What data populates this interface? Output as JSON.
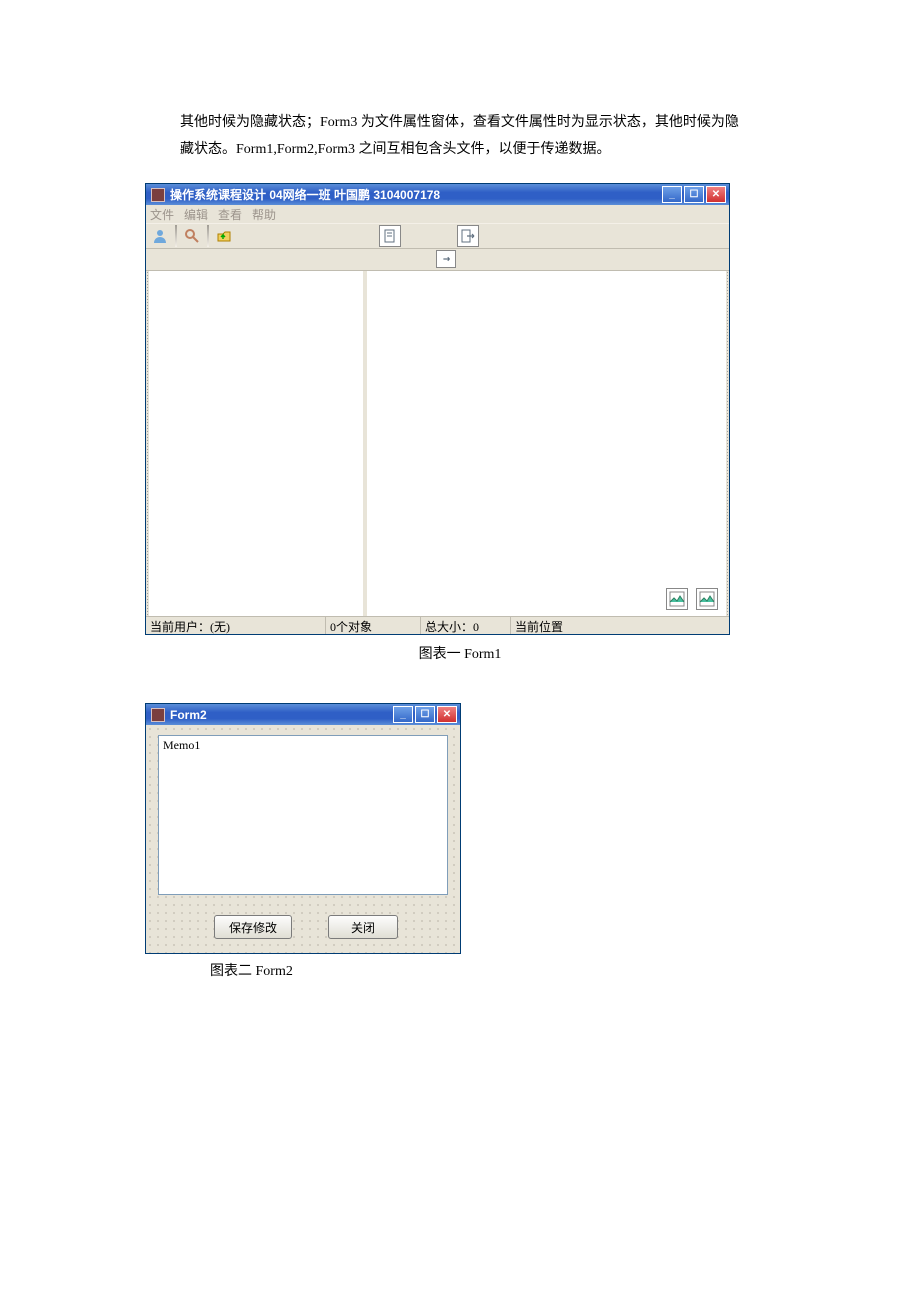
{
  "body": {
    "p1": "其他时候为隐藏状态；Form3 为文件属性窗体，查看文件属性时为显示状态，其他时候为隐藏状态。Form1,Form2,Form3 之间互相包含头文件，以便于传递数据。"
  },
  "form1": {
    "title": "操作系统课程设计   04网络一班  叶国鹏  3104007178",
    "menu": {
      "file": "文件",
      "edit": "编辑",
      "view": "查看",
      "help": "帮助"
    },
    "status": {
      "user_label": "当前用户：(无)",
      "objects": "0个对象",
      "size": "总大小：0",
      "location": "当前位置"
    }
  },
  "captions": {
    "fig1": "图表一  Form1",
    "fig2": "图表二  Form2"
  },
  "form2": {
    "title": "Form2",
    "memo": "Memo1",
    "save": "保存修改",
    "close": "关闭"
  }
}
